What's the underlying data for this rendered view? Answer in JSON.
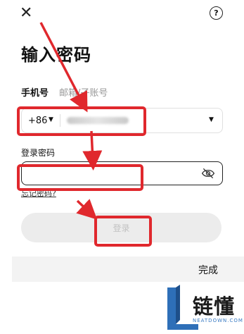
{
  "header": {
    "close_glyph": "✕",
    "help_glyph": "?"
  },
  "title": "输入密码",
  "tabs": [
    {
      "label": "手机号"
    },
    {
      "label": "邮箱/子账号"
    }
  ],
  "phone": {
    "country_code": "+86",
    "number_masked": "",
    "dropdown_glyph": "▼"
  },
  "password": {
    "label": "登录密码",
    "value": ""
  },
  "forgot_link": "忘记密码?",
  "login_button": "登录",
  "keyboard_bar": {
    "done_label": "完成"
  },
  "watermark": {
    "brand_cn": "链懂",
    "brand_en": "NEATDOWN.COM"
  },
  "colors": {
    "annotation_red": "#e0282d",
    "logo_blue": "#3a7cc4"
  },
  "icons": [
    "close-icon",
    "help-icon",
    "chevron-down-icon",
    "eye-off-icon"
  ]
}
